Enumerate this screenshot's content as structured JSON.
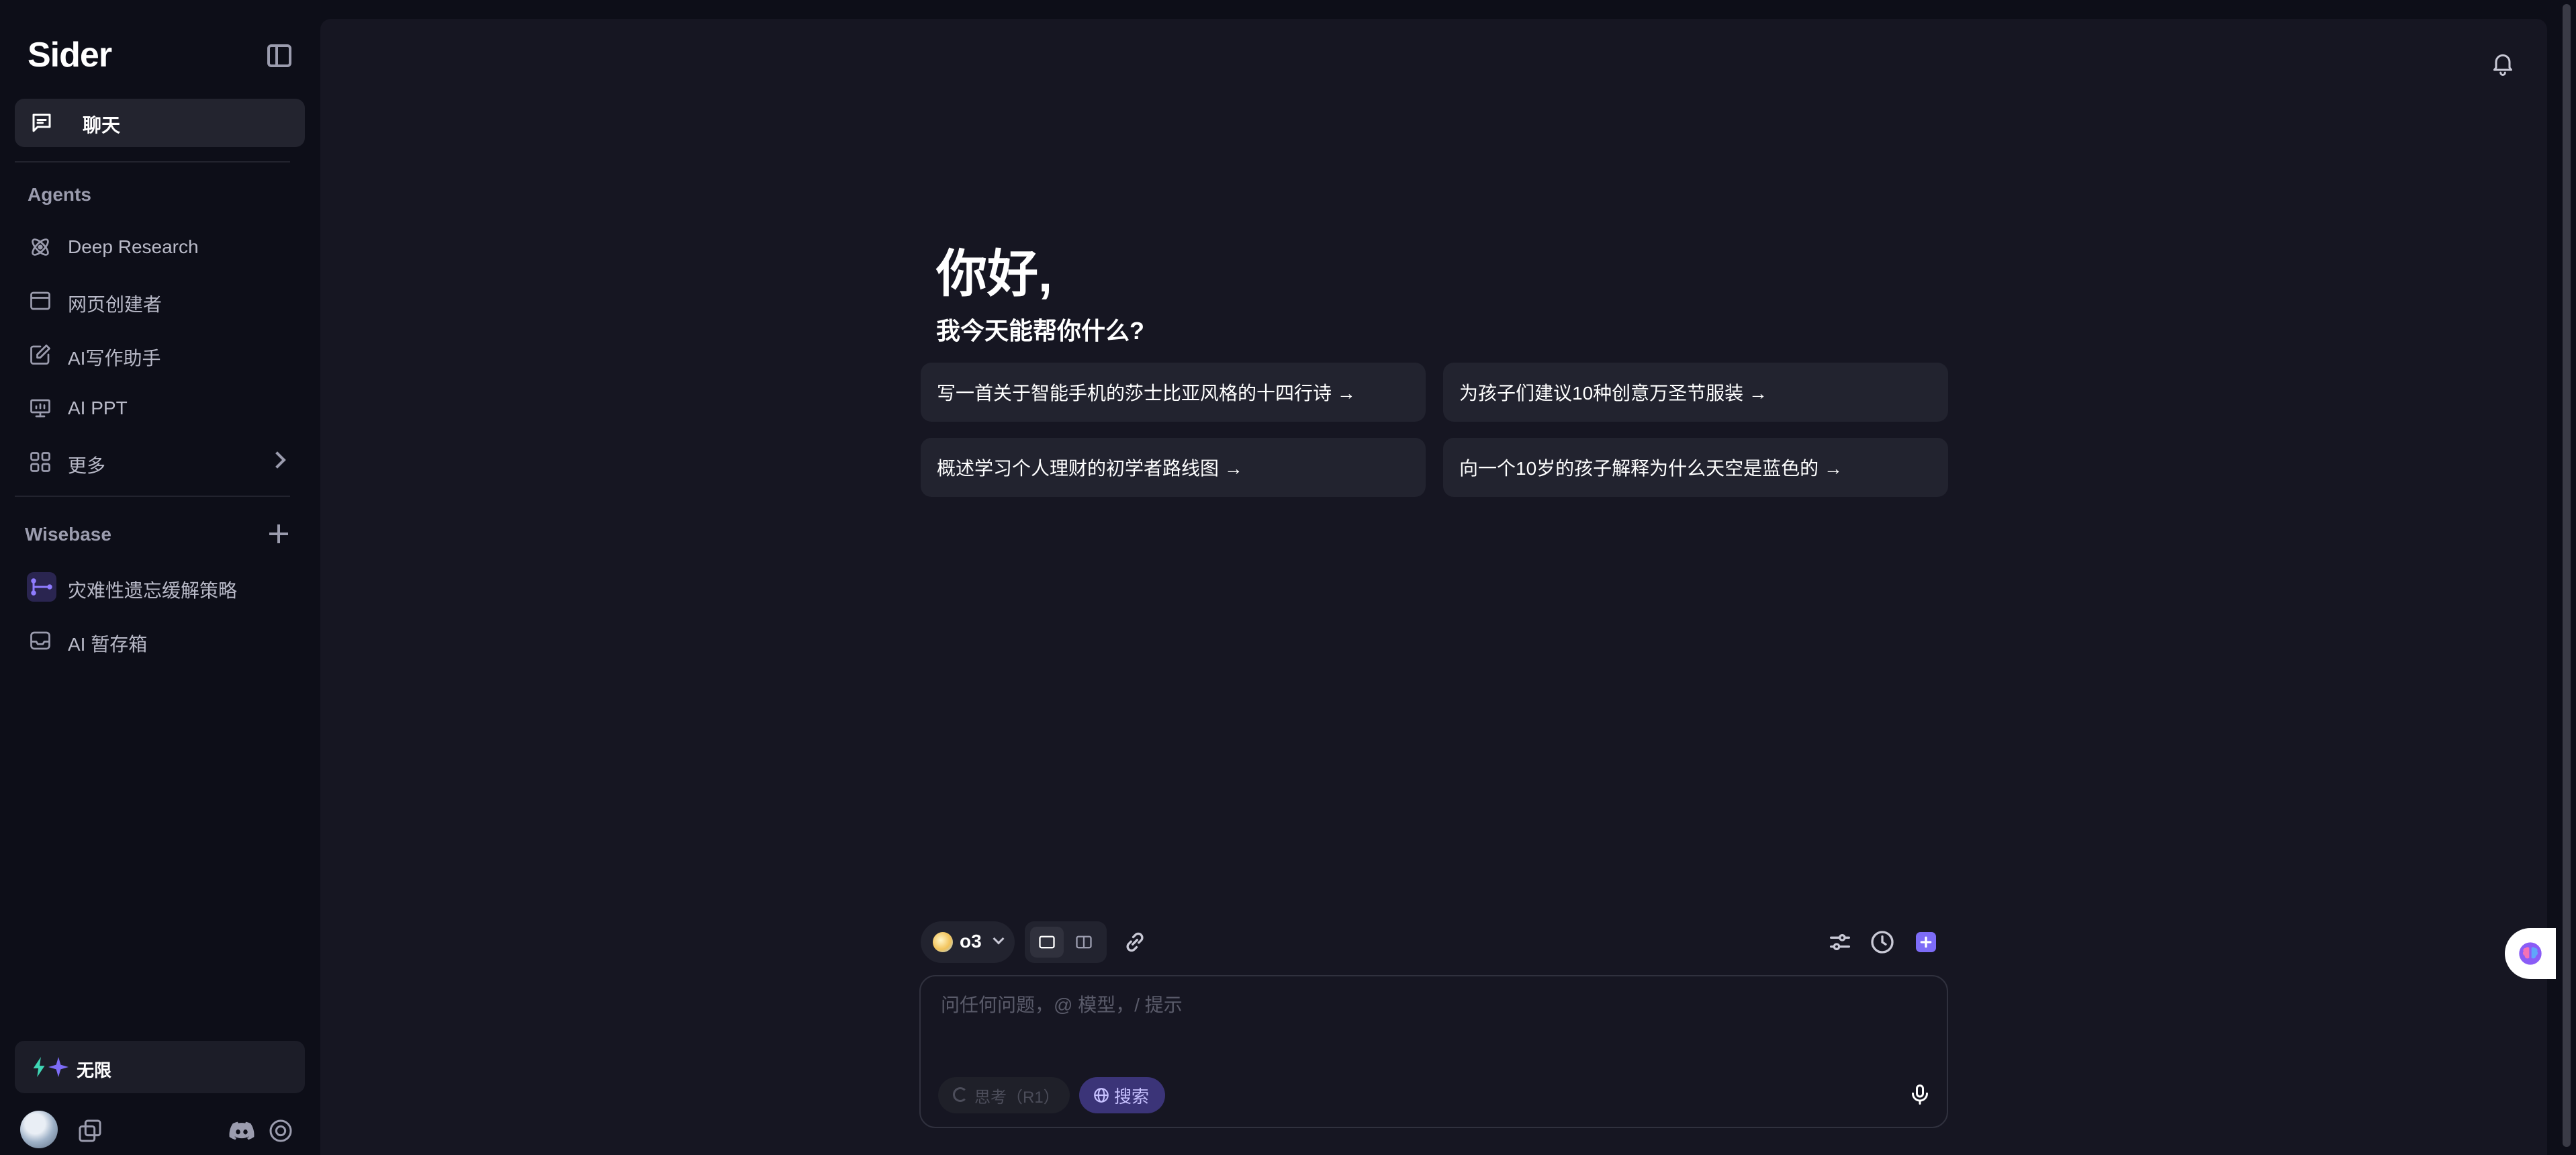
{
  "sidebar": {
    "logo": "Sider",
    "chat_label": "聊天",
    "agents_title": "Agents",
    "agents": [
      {
        "label": "Deep Research",
        "icon": "atom-icon"
      },
      {
        "label": "网页创建者",
        "icon": "browser-window-icon"
      },
      {
        "label": "AI写作助手",
        "icon": "edit-icon"
      },
      {
        "label": "AI PPT",
        "icon": "presentation-icon"
      },
      {
        "label": "更多",
        "icon": "grid-icon"
      }
    ],
    "wisebase_title": "Wisebase",
    "wisebase_items": [
      {
        "label": "灾难性遗忘缓解策略",
        "icon": "flow-icon"
      },
      {
        "label": "AI 暂存箱",
        "icon": "inbox-icon"
      }
    ],
    "plan_label": "无限"
  },
  "main": {
    "greeting": "你好,",
    "subgreeting": "我今天能帮你什么?",
    "suggestions": [
      "写一首关于智能手机的莎士比亚风格的十四行诗 →",
      "为孩子们建议10种创意万圣节服装 →",
      "概述学习个人理财的初学者路线图 →",
      "向一个10岁的孩子解释为什么天空是蓝色的 →"
    ],
    "model": "o3",
    "input_placeholder": "问任何问题，@ 模型，/ 提示",
    "think_label": "思考（R1）",
    "search_label": "搜索"
  },
  "colors": {
    "background": "#0d0e18",
    "panel": "#161622",
    "card": "#22232f",
    "accent": "#6b5cf5"
  }
}
